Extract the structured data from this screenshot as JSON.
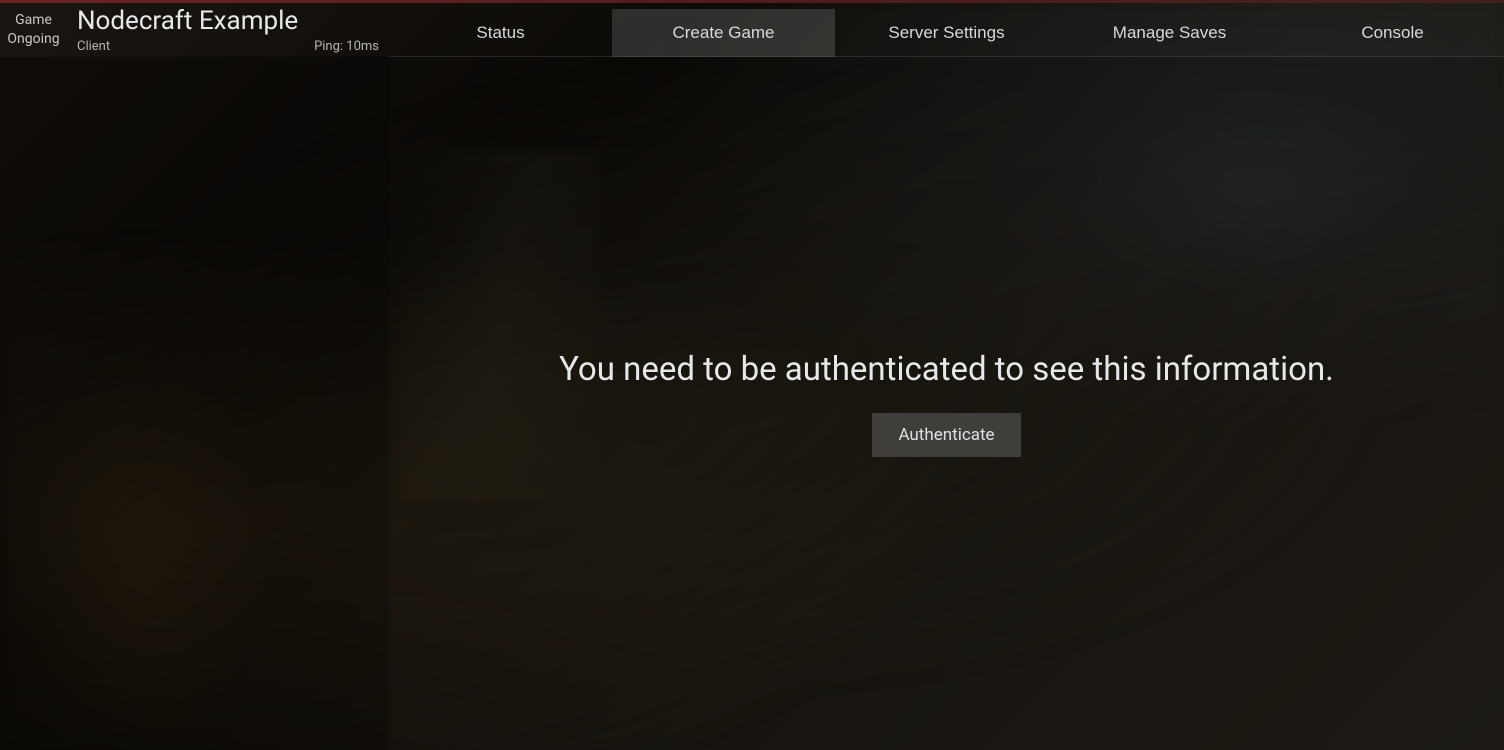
{
  "status": {
    "line1": "Game",
    "line2": "Ongoing"
  },
  "server": {
    "title": "Nodecraft Example",
    "role": "Client",
    "ping": "Ping: 10ms"
  },
  "tabs": {
    "status": "Status",
    "create_game": "Create Game",
    "server_settings": "Server Settings",
    "manage_saves": "Manage Saves",
    "console": "Console",
    "active": "create_game"
  },
  "auth": {
    "message": "You need to be authenticated to see this information.",
    "button": "Authenticate"
  }
}
